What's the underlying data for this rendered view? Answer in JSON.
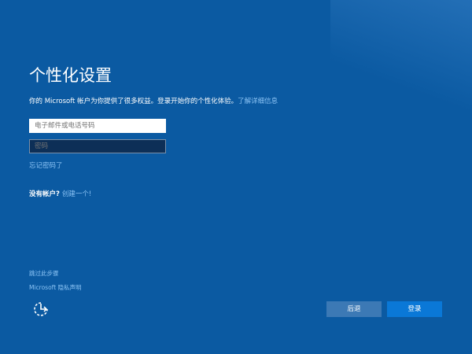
{
  "title": "个性化设置",
  "subtitle": "你的 Microsoft 帐户为你提供了很多权益。登录开始你的个性化体验。",
  "learn_more": "了解详细信息",
  "email_placeholder": "电子邮件或电话号码",
  "password_placeholder": "密码",
  "forgot_password": "忘记密码了",
  "no_account": "没有帐户?",
  "create_one": "创建一个!",
  "skip": "跳过此步骤",
  "privacy": "Microsoft 隐私声明",
  "buttons": {
    "back": "后退",
    "sign_in": "登录"
  },
  "icons": {
    "accessibility": "ease-of-access-icon"
  }
}
